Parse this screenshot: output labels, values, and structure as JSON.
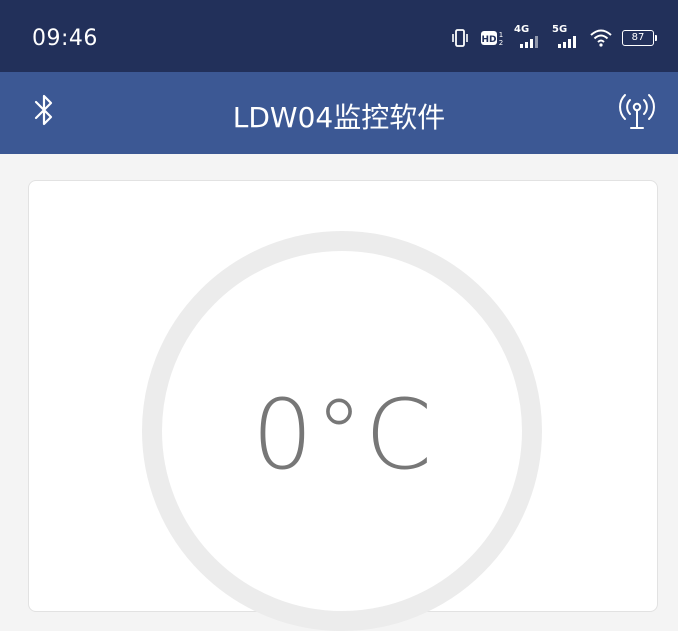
{
  "status_bar": {
    "time": "09:46",
    "net1_label": "4G",
    "net2_label": "5G",
    "battery_level": "87",
    "icons": [
      "vibrate-icon",
      "hd-icon",
      "signal-4g-icon",
      "signal-5g-icon",
      "wifi-icon",
      "battery-icon"
    ]
  },
  "app_bar": {
    "title": "LDW04监控软件",
    "left_icon": "bluetooth-icon",
    "right_icon": "antenna-icon"
  },
  "main": {
    "temperature": "0°C"
  },
  "colors": {
    "status_bar_bg": "#22305a",
    "app_bar_bg": "#3c5894",
    "ring": "#ececec",
    "temp_text": "#777777"
  }
}
